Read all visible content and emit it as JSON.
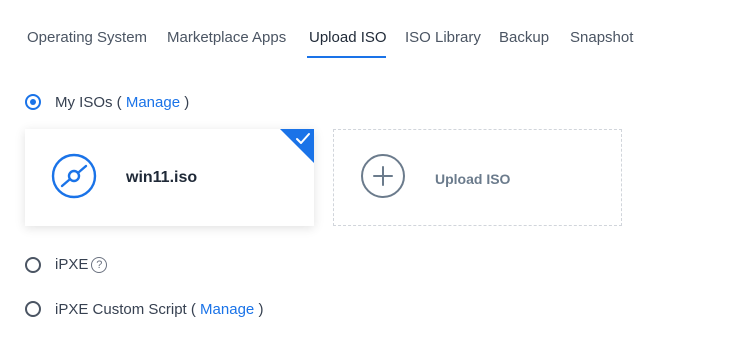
{
  "tabs": [
    {
      "label": "Operating System"
    },
    {
      "label": "Marketplace Apps"
    },
    {
      "label": "Upload ISO"
    },
    {
      "label": "ISO Library"
    },
    {
      "label": "Backup"
    },
    {
      "label": "Snapshot"
    }
  ],
  "active_tab": "Upload ISO",
  "options": {
    "my_isos": {
      "label": "My ISOs (",
      "link": "Manage",
      "suffix": ")",
      "selected": true
    },
    "ipxe": {
      "label": "iPXE",
      "selected": false
    },
    "ipxe_custom": {
      "label": "iPXE Custom Script (",
      "link": "Manage",
      "suffix": ")",
      "selected": false
    }
  },
  "iso_card": {
    "name": "win11.iso",
    "icon": "disc-icon",
    "selected": true
  },
  "upload_card": {
    "label": "Upload ISO",
    "icon": "plus-circle-icon"
  },
  "colors": {
    "accent": "#1a73e8",
    "text": "#374151",
    "muted": "#6b7b8c"
  }
}
